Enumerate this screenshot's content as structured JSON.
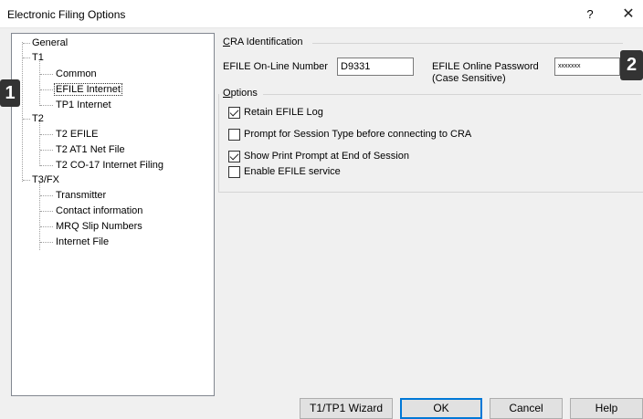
{
  "window": {
    "title": "Electronic Filing Options",
    "help_glyph": "?",
    "close_glyph": "✕"
  },
  "callouts": [
    "1",
    "2"
  ],
  "tree": {
    "items": [
      {
        "label": "General"
      },
      {
        "label": "T1"
      },
      {
        "label": "Common"
      },
      {
        "label": "EFILE Internet",
        "selected": true
      },
      {
        "label": "TP1 Internet"
      },
      {
        "label": "T2"
      },
      {
        "label": "T2 EFILE"
      },
      {
        "label": "T2 AT1 Net File"
      },
      {
        "label": "T2 CO-17 Internet Filing"
      },
      {
        "label": "T3/FX"
      },
      {
        "label": "Transmitter"
      },
      {
        "label": "Contact information"
      },
      {
        "label": "MRQ Slip Numbers"
      },
      {
        "label": "Internet File"
      }
    ]
  },
  "cra": {
    "group_first": "C",
    "group_rest": "RA Identification",
    "online_number_label": "EFILE On-Line Number",
    "online_number_value": "D9331",
    "password_label_line1": "EFILE Online Password",
    "password_label_line2": "(Case Sensitive)",
    "password_value": "xxxxxxx"
  },
  "options": {
    "group_first": "O",
    "group_rest": "ptions",
    "items": [
      {
        "label": "Retain EFILE Log",
        "checked": true
      },
      {
        "label": "Prompt for Session Type before connecting to CRA",
        "checked": false
      },
      {
        "label": "Show Print Prompt at End of Session",
        "checked": true
      },
      {
        "label": "Enable EFILE service",
        "checked": false
      }
    ]
  },
  "buttons": {
    "wizard": "T1/TP1 Wizard",
    "ok": "OK",
    "cancel": "Cancel",
    "help": "Help"
  }
}
